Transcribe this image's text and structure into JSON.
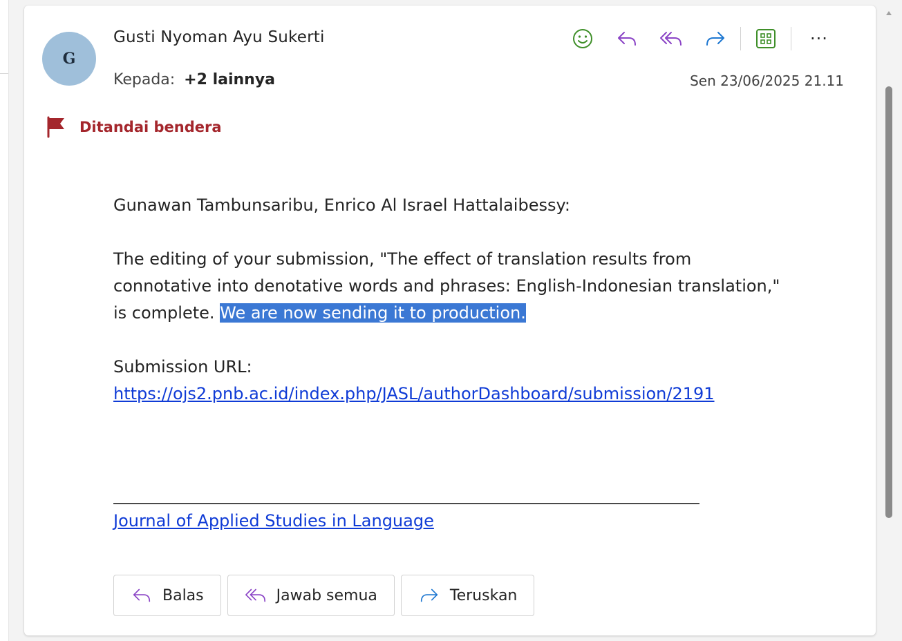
{
  "message": {
    "avatar_initial": "G",
    "sender_name": "Gusti Nyoman Ayu Sukerti",
    "to_label": "Kepada:",
    "to_more": "+2 lainnya",
    "date": "Sen 23/06/2025 21.11",
    "flag_label": "Ditandai bendera"
  },
  "body": {
    "greeting": "Gunawan Tambunsaribu, Enrico Al Israel Hattalaibessy:",
    "para1_line1": "The editing of your submission, \"The effect of translation results from",
    "para1_line2": "connotative into denotative words and phrases: English-Indonesian translation,\"",
    "para1_line3_plain": "is complete. ",
    "para1_line3_selected": "We are now sending it to production.",
    "url_label": "Submission URL:",
    "url": "https://ojs2.pnb.ac.id/index.php/JASL/authorDashboard/submission/2191",
    "journal_link": "Journal of Applied Studies in Language"
  },
  "buttons": {
    "reply": "Balas",
    "reply_all": "Jawab semua",
    "forward": "Teruskan"
  },
  "toolbar": {
    "more": "···"
  },
  "colors": {
    "emoji": "#3f8f29",
    "reply_purple": "#8b44c6",
    "forward_blue": "#1f78d1",
    "flag_red": "#a4262c",
    "selection": "#3b78d4",
    "link": "#0f3bd6"
  }
}
